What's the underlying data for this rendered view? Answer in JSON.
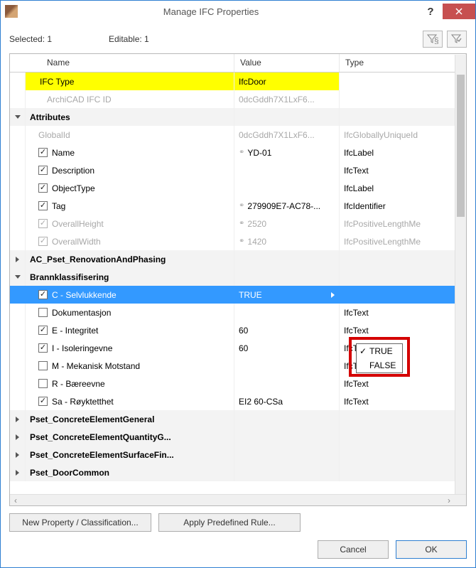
{
  "window": {
    "title": "Manage IFC Properties"
  },
  "toolbar": {
    "selected_label": "Selected: 1",
    "editable_label": "Editable: 1"
  },
  "columns": {
    "name": "Name",
    "value": "Value",
    "type": "Type"
  },
  "rows": [
    {
      "kind": "highlight",
      "name": "IFC Type",
      "value": "IfcDoor",
      "type": ""
    },
    {
      "kind": "disabled",
      "name": "ArchiCAD IFC ID",
      "value": "0dcGddh7X1LxF6...",
      "type": ""
    },
    {
      "kind": "group",
      "name": "Attributes"
    },
    {
      "kind": "attr-disabled",
      "name": "GlobalId",
      "value": "0dcGddh7X1LxF6...",
      "type": "IfcGloballyUniqueId"
    },
    {
      "kind": "attr",
      "checked": true,
      "link": true,
      "name": "Name",
      "value": "YD-01",
      "type": "IfcLabel"
    },
    {
      "kind": "attr",
      "checked": true,
      "link": false,
      "name": "Description",
      "value": "",
      "type": "IfcText"
    },
    {
      "kind": "attr",
      "checked": true,
      "link": false,
      "name": "ObjectType",
      "value": "",
      "type": "IfcLabel"
    },
    {
      "kind": "attr",
      "checked": true,
      "link": true,
      "name": "Tag",
      "value": "279909E7-AC78-...",
      "type": "IfcIdentifier"
    },
    {
      "kind": "attr-disabled",
      "checked": true,
      "link": true,
      "name": "OverallHeight",
      "value": "2520",
      "type": "IfcPositiveLengthMe"
    },
    {
      "kind": "attr-disabled",
      "checked": true,
      "link": true,
      "name": "OverallWidth",
      "value": "1420",
      "type": "IfcPositiveLengthMe"
    },
    {
      "kind": "pset-collapsed",
      "name": "AC_Pset_RenovationAndPhasing"
    },
    {
      "kind": "pset-expanded",
      "name": "Brannklassifisering"
    },
    {
      "kind": "prop-selected",
      "checked": true,
      "name": "C - Selvlukkende",
      "value": "TRUE",
      "type": ""
    },
    {
      "kind": "prop",
      "checked": false,
      "name": "Dokumentasjon",
      "value": "",
      "type": "IfcText"
    },
    {
      "kind": "prop",
      "checked": true,
      "name": "E - Integritet",
      "value": "60",
      "type": "IfcText"
    },
    {
      "kind": "prop",
      "checked": true,
      "name": "I - Isoleringevne",
      "value": "60",
      "type": "IfcText"
    },
    {
      "kind": "prop",
      "checked": false,
      "name": "M - Mekanisk Motstand",
      "value": "",
      "type": "IfcText"
    },
    {
      "kind": "prop",
      "checked": false,
      "name": "R - Bæreevne",
      "value": "",
      "type": "IfcText"
    },
    {
      "kind": "prop",
      "checked": true,
      "name": "Sa - Røyktetthet",
      "value": "EI2 60-CSa",
      "type": "IfcText"
    },
    {
      "kind": "pset-collapsed",
      "name": "Pset_ConcreteElementGeneral"
    },
    {
      "kind": "pset-collapsed",
      "name": "Pset_ConcreteElementQuantityG..."
    },
    {
      "kind": "pset-collapsed",
      "name": "Pset_ConcreteElementSurfaceFin..."
    },
    {
      "kind": "pset-collapsed",
      "name": "Pset_DoorCommon"
    }
  ],
  "popup": {
    "true": "TRUE",
    "false": "FALSE"
  },
  "buttons": {
    "new_prop": "New Property / Classification...",
    "apply_rule": "Apply Predefined Rule...",
    "cancel": "Cancel",
    "ok": "OK"
  }
}
